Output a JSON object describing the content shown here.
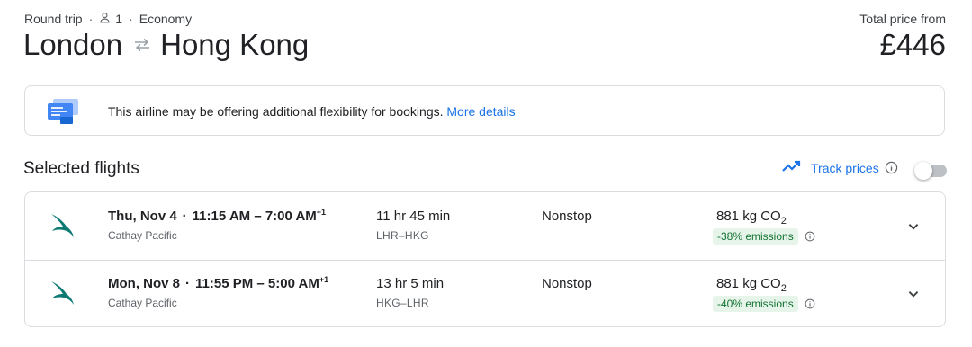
{
  "trip": {
    "type": "Round trip",
    "passengers": "1",
    "cabin": "Economy",
    "origin": "London",
    "destination": "Hong Kong",
    "price_label": "Total price from",
    "price": "£446"
  },
  "banner": {
    "text": "This airline may be offering additional flexibility for bookings.",
    "link": "More details"
  },
  "section": {
    "title": "Selected flights",
    "track_label": "Track prices",
    "track_enabled": false
  },
  "flights": [
    {
      "date": "Thu, Nov 4",
      "time_range": "11:15 AM – 7:00 AM",
      "day_offset": "+1",
      "airline": "Cathay Pacific",
      "duration": "11 hr 45 min",
      "route": "LHR–HKG",
      "stops": "Nonstop",
      "co2": "881 kg CO",
      "co2_sub": "2",
      "emissions": "-38% emissions"
    },
    {
      "date": "Mon, Nov 8",
      "time_range": "11:55 PM – 5:00 AM",
      "day_offset": "+1",
      "airline": "Cathay Pacific",
      "duration": "13 hr 5 min",
      "route": "HKG–LHR",
      "stops": "Nonstop",
      "co2": "881 kg CO",
      "co2_sub": "2",
      "emissions": "-40% emissions"
    }
  ],
  "colors": {
    "accent": "#1a73e8",
    "airline_logo": "#0e7a74",
    "emissions_bg": "#e6f4ea",
    "emissions_text": "#137333"
  },
  "icons": {
    "passenger": "person-icon",
    "swap": "swap-arrows-icon",
    "banner": "ticket-illustration-icon",
    "track": "trending-up-icon",
    "info": "info-icon",
    "airline": "cathay-pacific-logo-icon",
    "expand": "chevron-down-icon"
  }
}
